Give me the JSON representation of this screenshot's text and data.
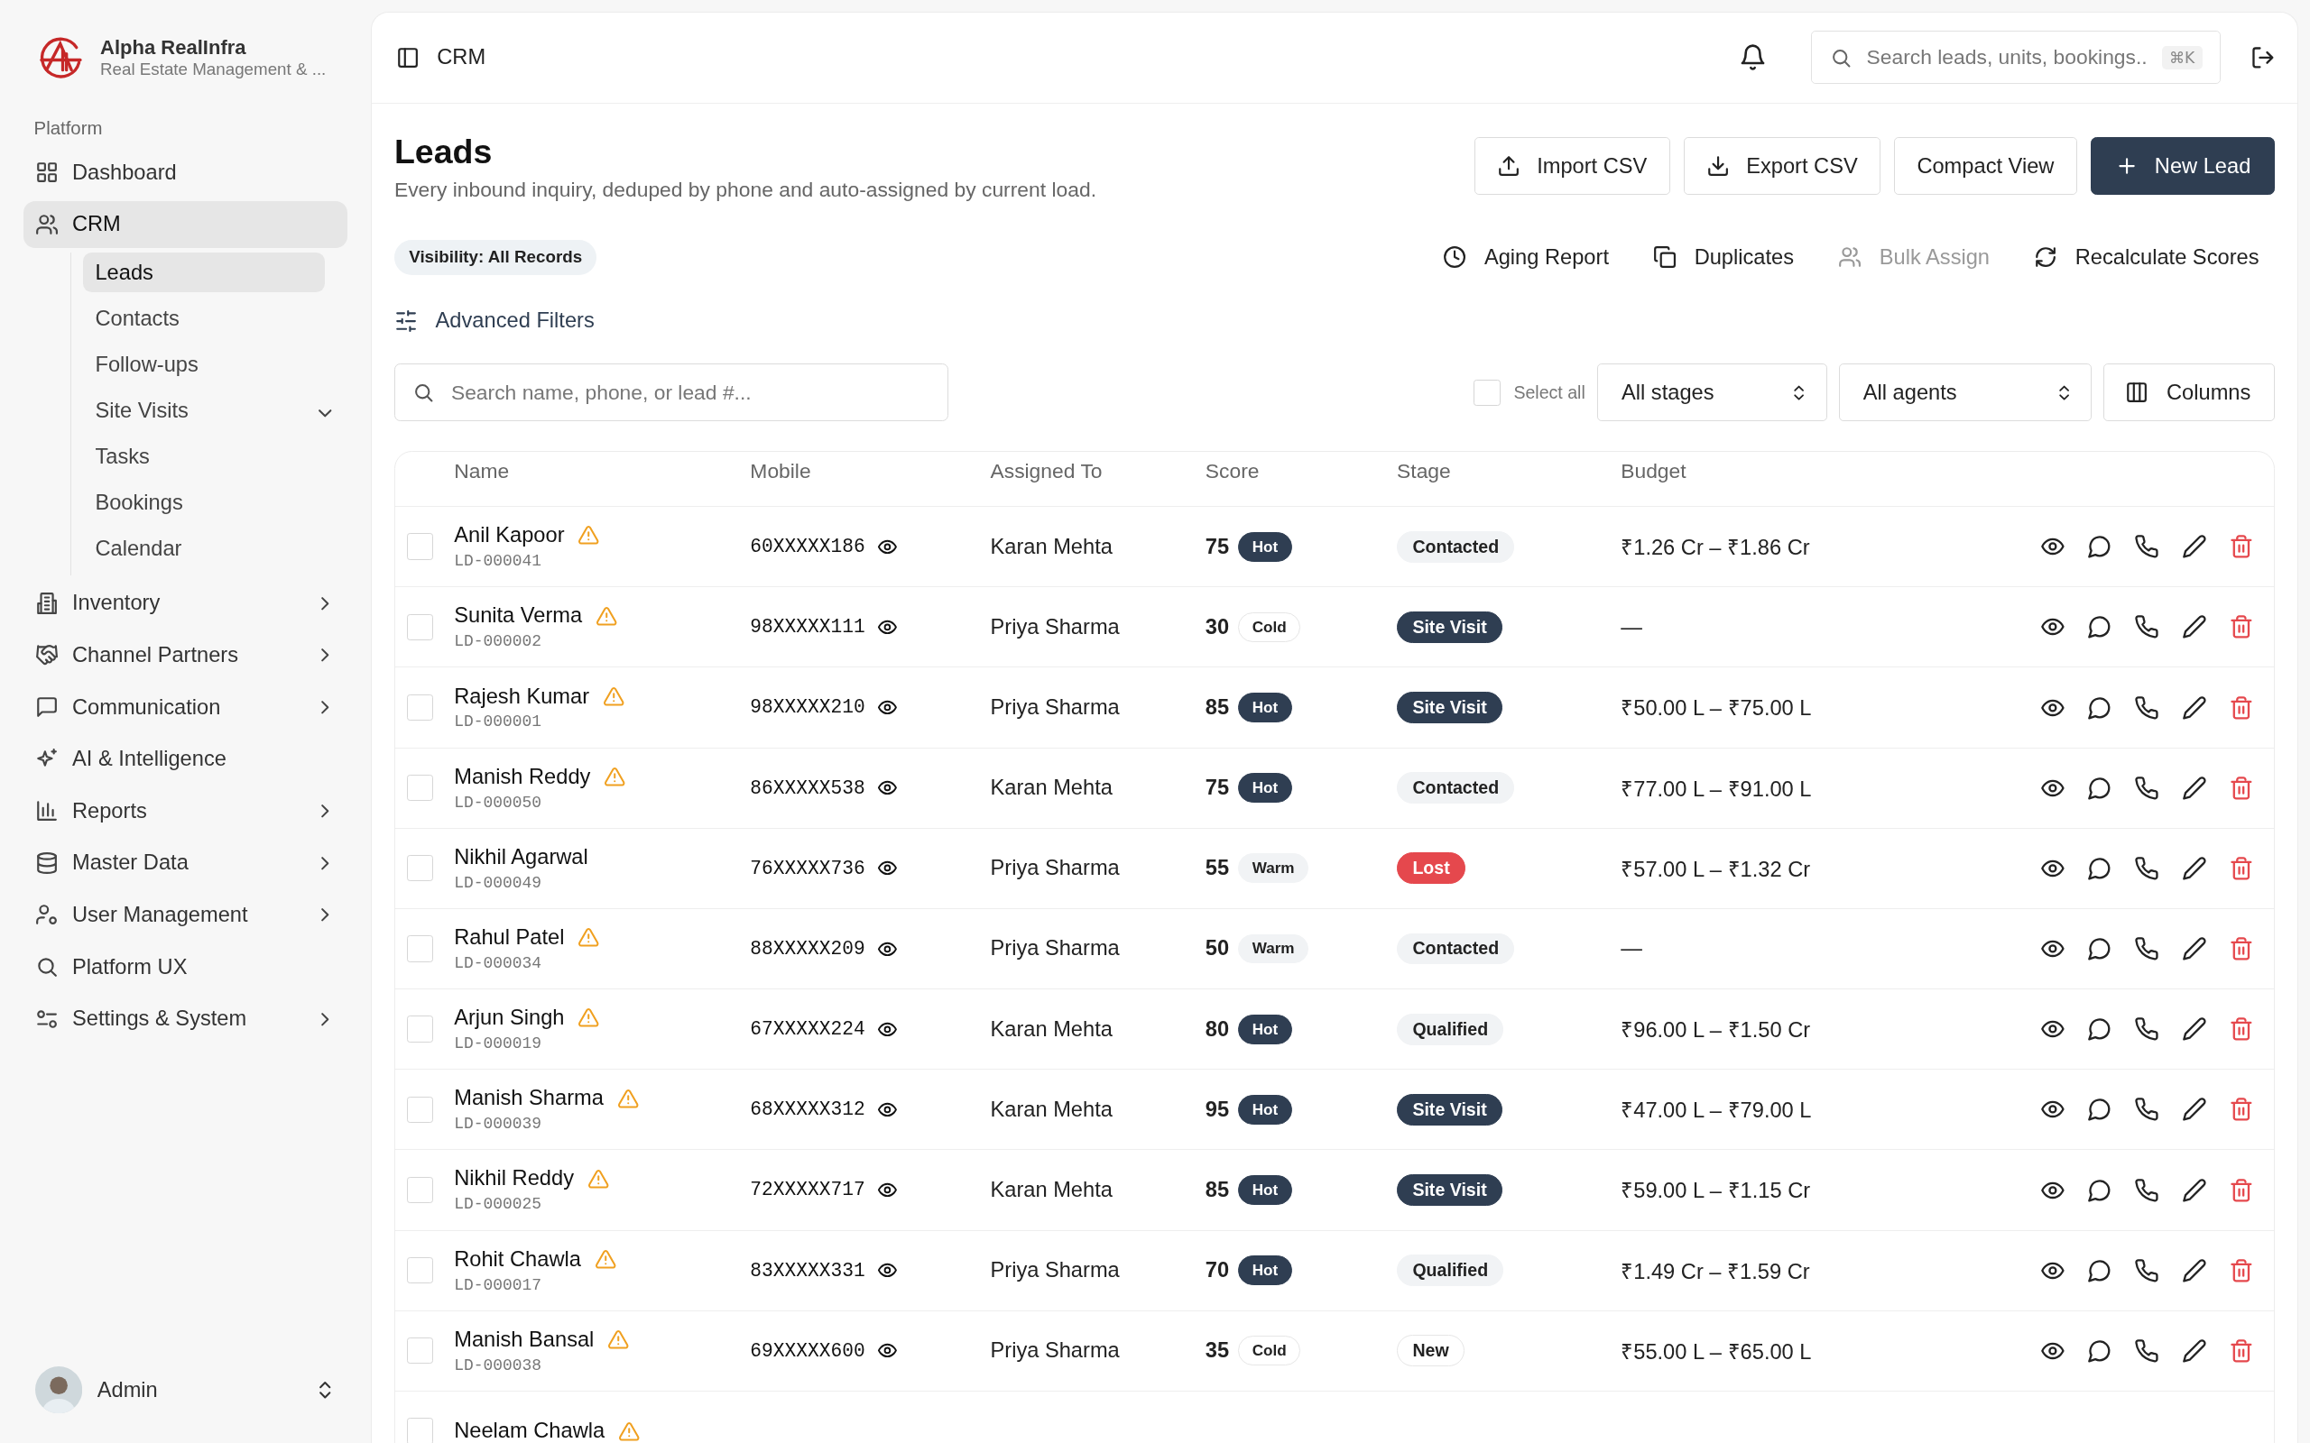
{
  "brand": {
    "name": "Alpha RealInfra",
    "subtitle": "Real Estate Management & ..."
  },
  "sidebar": {
    "section_label": "Platform",
    "items": [
      {
        "label": "Dashboard",
        "selected": false,
        "expandable": false
      },
      {
        "label": "CRM",
        "selected": true,
        "expandable": true,
        "expanded": true,
        "children": [
          {
            "label": "Leads",
            "selected": true
          },
          {
            "label": "Contacts",
            "selected": false
          },
          {
            "label": "Follow-ups",
            "selected": false
          },
          {
            "label": "Site Visits",
            "selected": false
          },
          {
            "label": "Tasks",
            "selected": false
          },
          {
            "label": "Bookings",
            "selected": false
          },
          {
            "label": "Calendar",
            "selected": false
          }
        ]
      },
      {
        "label": "Inventory",
        "selected": false,
        "expandable": true,
        "expanded": false
      },
      {
        "label": "Channel Partners",
        "selected": false,
        "expandable": true,
        "expanded": false
      },
      {
        "label": "Communication",
        "selected": false,
        "expandable": true,
        "expanded": false
      },
      {
        "label": "AI & Intelligence",
        "selected": false,
        "expandable": false
      },
      {
        "label": "Reports",
        "selected": false,
        "expandable": true,
        "expanded": false
      },
      {
        "label": "Master Data",
        "selected": false,
        "expandable": true,
        "expanded": false
      },
      {
        "label": "User Management",
        "selected": false,
        "expandable": true,
        "expanded": false
      },
      {
        "label": "Platform UX",
        "selected": false,
        "expandable": false
      },
      {
        "label": "Settings & System",
        "selected": false,
        "expandable": true,
        "expanded": false
      }
    ],
    "user": {
      "name": "Admin"
    }
  },
  "topbar": {
    "breadcrumb": "CRM",
    "search": {
      "placeholder": "Search leads, units, bookings...",
      "shortcut": "⌘K"
    }
  },
  "page": {
    "title": "Leads",
    "subtitle": "Every inbound inquiry, deduped by phone and auto-assigned by current load.",
    "buttons": [
      {
        "label": "Import CSV",
        "kind": "import"
      },
      {
        "label": "Export CSV",
        "kind": "export"
      },
      {
        "label": "Compact View",
        "kind": "plain"
      },
      {
        "label": "New Lead",
        "kind": "primary"
      }
    ],
    "visibility_badge": "Visibility: All Records",
    "quick_actions": [
      {
        "label": "Aging Report",
        "disabled": false
      },
      {
        "label": "Duplicates",
        "disabled": false
      },
      {
        "label": "Bulk Assign",
        "disabled": true
      },
      {
        "label": "Recalculate Scores",
        "disabled": false
      }
    ],
    "advanced_filters": "Advanced Filters",
    "search": {
      "placeholder": "Search name, phone, or lead #..."
    },
    "select_all": {
      "label": "Select all",
      "checked": false
    },
    "dropdowns": [
      "All stages",
      "All agents"
    ],
    "columns_button": "Columns"
  },
  "table": {
    "columns": [
      "Name",
      "Mobile",
      "Assigned To",
      "Score",
      "Stage",
      "Budget"
    ],
    "rows": [
      {
        "checked": false,
        "name": "Anil Kapoor",
        "warning": true,
        "lead_id": "LD-000041",
        "mobile": "60XXXXX186",
        "assigned_to": "Karan Mehta",
        "score": "75",
        "temperature": {
          "label": "Hot",
          "kind": "hot"
        },
        "stage": {
          "label": "Contacted",
          "kind": "contacted"
        },
        "budget": "₹1.26 Cr – ₹1.86 Cr"
      },
      {
        "checked": false,
        "name": "Sunita Verma",
        "warning": true,
        "lead_id": "LD-000002",
        "mobile": "98XXXXX111",
        "assigned_to": "Priya Sharma",
        "score": "30",
        "temperature": {
          "label": "Cold",
          "kind": "cold"
        },
        "stage": {
          "label": "Site Visit",
          "kind": "site_visit"
        },
        "budget": "—"
      },
      {
        "checked": false,
        "name": "Rajesh Kumar",
        "warning": true,
        "lead_id": "LD-000001",
        "mobile": "98XXXXX210",
        "assigned_to": "Priya Sharma",
        "score": "85",
        "temperature": {
          "label": "Hot",
          "kind": "hot"
        },
        "stage": {
          "label": "Site Visit",
          "kind": "site_visit"
        },
        "budget": "₹50.00 L – ₹75.00 L"
      },
      {
        "checked": false,
        "name": "Manish Reddy",
        "warning": true,
        "lead_id": "LD-000050",
        "mobile": "86XXXXX538",
        "assigned_to": "Karan Mehta",
        "score": "75",
        "temperature": {
          "label": "Hot",
          "kind": "hot"
        },
        "stage": {
          "label": "Contacted",
          "kind": "contacted"
        },
        "budget": "₹77.00 L – ₹91.00 L"
      },
      {
        "checked": false,
        "name": "Nikhil Agarwal",
        "warning": false,
        "lead_id": "LD-000049",
        "mobile": "76XXXXX736",
        "assigned_to": "Priya Sharma",
        "score": "55",
        "temperature": {
          "label": "Warm",
          "kind": "warm"
        },
        "stage": {
          "label": "Lost",
          "kind": "lost"
        },
        "budget": "₹57.00 L – ₹1.32 Cr"
      },
      {
        "checked": false,
        "name": "Rahul Patel",
        "warning": true,
        "lead_id": "LD-000034",
        "mobile": "88XXXXX209",
        "assigned_to": "Priya Sharma",
        "score": "50",
        "temperature": {
          "label": "Warm",
          "kind": "warm"
        },
        "stage": {
          "label": "Contacted",
          "kind": "contacted"
        },
        "budget": "—"
      },
      {
        "checked": false,
        "name": "Arjun Singh",
        "warning": true,
        "lead_id": "LD-000019",
        "mobile": "67XXXXX224",
        "assigned_to": "Karan Mehta",
        "score": "80",
        "temperature": {
          "label": "Hot",
          "kind": "hot"
        },
        "stage": {
          "label": "Qualified",
          "kind": "qualified"
        },
        "budget": "₹96.00 L – ₹1.50 Cr"
      },
      {
        "checked": false,
        "name": "Manish Sharma",
        "warning": true,
        "lead_id": "LD-000039",
        "mobile": "68XXXXX312",
        "assigned_to": "Karan Mehta",
        "score": "95",
        "temperature": {
          "label": "Hot",
          "kind": "hot"
        },
        "stage": {
          "label": "Site Visit",
          "kind": "site_visit"
        },
        "budget": "₹47.00 L – ₹79.00 L"
      },
      {
        "checked": false,
        "name": "Nikhil Reddy",
        "warning": true,
        "lead_id": "LD-000025",
        "mobile": "72XXXXX717",
        "assigned_to": "Karan Mehta",
        "score": "85",
        "temperature": {
          "label": "Hot",
          "kind": "hot"
        },
        "stage": {
          "label": "Site Visit",
          "kind": "site_visit"
        },
        "budget": "₹59.00 L – ₹1.15 Cr"
      },
      {
        "checked": false,
        "name": "Rohit Chawla",
        "warning": true,
        "lead_id": "LD-000017",
        "mobile": "83XXXXX331",
        "assigned_to": "Priya Sharma",
        "score": "70",
        "temperature": {
          "label": "Hot",
          "kind": "hot"
        },
        "stage": {
          "label": "Qualified",
          "kind": "qualified"
        },
        "budget": "₹1.49 Cr – ₹1.59 Cr"
      },
      {
        "checked": false,
        "name": "Manish Bansal",
        "warning": true,
        "lead_id": "LD-000038",
        "mobile": "69XXXXX600",
        "assigned_to": "Priya Sharma",
        "score": "35",
        "temperature": {
          "label": "Cold",
          "kind": "cold"
        },
        "stage": {
          "label": "New",
          "kind": "new"
        },
        "budget": "₹55.00 L – ₹65.00 L"
      },
      {
        "checked": false,
        "name": "Neelam Chawla",
        "warning": true
      }
    ]
  }
}
